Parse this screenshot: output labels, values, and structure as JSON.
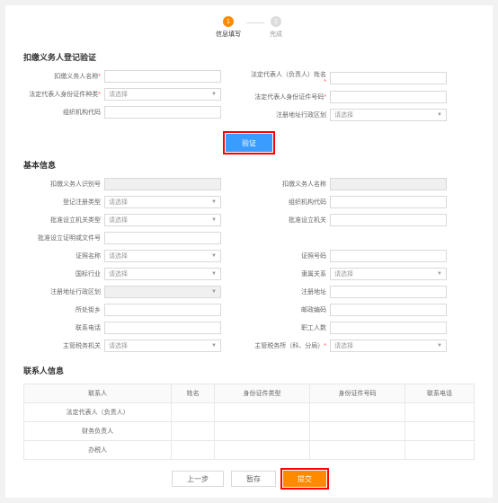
{
  "steps": {
    "s1": "信息填写",
    "s2": "完成",
    "n1": "1",
    "n2": "2"
  },
  "sec1": "扣缴义务人登记验证",
  "s1": {
    "name_lab": "扣缴义务人名称",
    "name_req": "*",
    "legal_lab": "法定代表人（负责人）姓名",
    "legal_req": "*",
    "idtype_lab": "法定代表人身份证件种类",
    "idtype_req": "*",
    "idtype_ph": "请选择",
    "idnum_lab": "法定代表人身份证件号码",
    "idnum_req": "*",
    "orgcode_lab": "组织机构代码",
    "area_lab": "注册地址行政区划",
    "area_ph": "请选择"
  },
  "btn_verify": "验证",
  "sec2": "基本信息",
  "s2": {
    "idno_lab": "扣缴义务人识别号",
    "name2_lab": "扣缴义务人名称",
    "regtype_lab": "登记注册类型",
    "regtype_ph": "请选择",
    "orgcode2_lab": "组织机构代码",
    "estype_lab": "批准设立机关类型",
    "estype_ph": "请选择",
    "esorg_lab": "批准设立机关",
    "esfile_lab": "批准设立证明或文件号",
    "certname_lab": "证照名称",
    "certname_ph": "请选择",
    "certno_lab": "证照号码",
    "industry_lab": "国标行业",
    "industry_ph": "请选择",
    "affil_lab": "隶属关系",
    "affil_ph": "请选择",
    "regarea_lab": "注册地址行政区划",
    "regaddr_lab": "注册地址",
    "street_lab": "所处街乡",
    "postcode_lab": "邮政编码",
    "phone_lab": "联系电话",
    "empcnt_lab": "职工人数",
    "taxorg_lab": "主管税务机关",
    "taxorg_ph": "请选择",
    "taxsub_lab": "主管税务所（科、分局）",
    "taxsub_req": "*",
    "taxsub_ph": "请选择"
  },
  "sec3": "联系人信息",
  "table": {
    "h1": "联系人",
    "h2": "姓名",
    "h3": "身份证件类型",
    "h4": "身份证件号码",
    "h5": "联系电话",
    "r1": "法定代表人（负责人）",
    "r2": "财务负责人",
    "r3": "办税人"
  },
  "btns": {
    "prev": "上一步",
    "save": "暂存",
    "submit": "提交"
  }
}
